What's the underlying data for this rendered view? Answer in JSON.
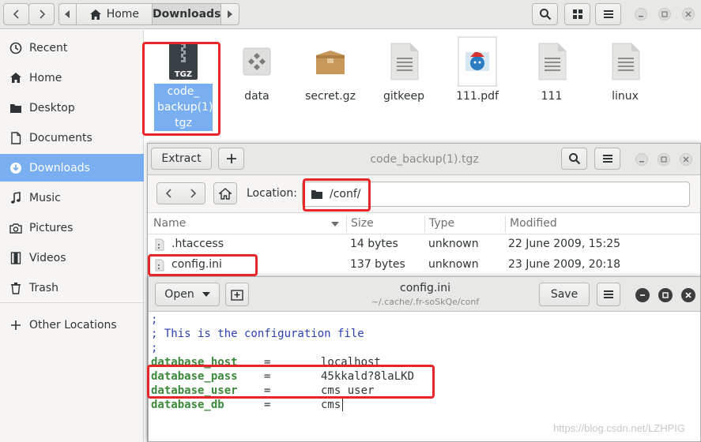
{
  "file_manager": {
    "pathbar": {
      "home_label": "Home",
      "current_label": "Downloads"
    },
    "sidebar": {
      "items": [
        {
          "label": "Recent",
          "icon": "clock-icon"
        },
        {
          "label": "Home",
          "icon": "home-icon"
        },
        {
          "label": "Desktop",
          "icon": "folder-icon"
        },
        {
          "label": "Documents",
          "icon": "document-icon"
        },
        {
          "label": "Downloads",
          "icon": "download-icon",
          "active": true
        },
        {
          "label": "Music",
          "icon": "music-icon"
        },
        {
          "label": "Pictures",
          "icon": "camera-icon"
        },
        {
          "label": "Videos",
          "icon": "film-icon"
        },
        {
          "label": "Trash",
          "icon": "trash-icon"
        }
      ],
      "other_locations": "Other Locations"
    },
    "files": [
      {
        "name": "code_\nbackup(1).\ntgz",
        "badge": "TGZ",
        "selected": true
      },
      {
        "name": "data"
      },
      {
        "name": "secret.gz"
      },
      {
        "name": "gitkeep"
      },
      {
        "name": "111.pdf"
      },
      {
        "name": "111"
      },
      {
        "name": "linux"
      }
    ]
  },
  "archive_manager": {
    "title": "code_backup(1).tgz",
    "extract_label": "Extract",
    "location_label": "Location:",
    "location_value": "/conf/",
    "columns": {
      "name": "Name",
      "size": "Size",
      "type": "Type",
      "modified": "Modified"
    },
    "rows": [
      {
        "name": ".htaccess",
        "size": "14 bytes",
        "type": "unknown",
        "modified": "22 June 2009, 15:25"
      },
      {
        "name": "config.ini",
        "size": "137 bytes",
        "type": "unknown",
        "modified": "23 June 2009, 20:18"
      }
    ]
  },
  "text_editor": {
    "open_label": "Open",
    "title": "config.ini",
    "subtitle": "~/.cache/.fr-soSkQe/conf",
    "save_label": "Save",
    "lines": [
      {
        "text": ";"
      },
      {
        "text": "; This is the configuration file"
      },
      {
        "text": ";"
      },
      {
        "key": "database_host",
        "eq": "=",
        "value": "localhost"
      },
      {
        "key": "database_pass",
        "eq": "=",
        "value": "45kkald?8laLKD"
      },
      {
        "key": "database_user",
        "eq": "=",
        "value": "cms_user"
      },
      {
        "key": "database_db",
        "eq": "=",
        "value": "cms"
      }
    ]
  },
  "watermark": "https://blog.csdn.net/LZHPIG",
  "colors": {
    "selection": "#79aef0",
    "highlight": "#e8262a",
    "comment": "#2c3fb0",
    "key": "#3a8a3a"
  }
}
